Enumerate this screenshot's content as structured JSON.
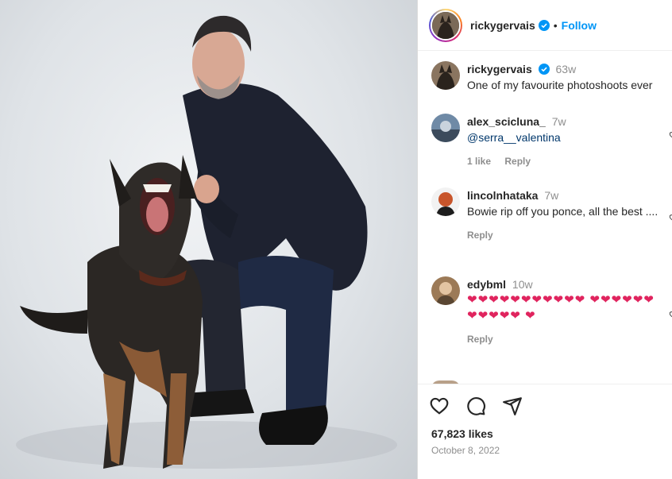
{
  "post": {
    "username": "rickygervais",
    "follow_label": "Follow",
    "dot": "•"
  },
  "caption": {
    "username": "rickygervais",
    "time": "63w",
    "text": "One of my favourite photoshoots ever"
  },
  "comments": [
    {
      "username": "alex_scicluna_",
      "time": "7w",
      "mention": "@serra__valentina",
      "likes": "1 like",
      "reply": "Reply"
    },
    {
      "username": "lincolnhataka",
      "time": "7w",
      "text": "Bowie rip off you ponce, all the best ....",
      "reply": "Reply"
    },
    {
      "username": "edybml",
      "time": "10w",
      "hearts": "❤❤❤❤❤❤❤❤❤❤❤ ❤❤❤❤❤❤❤❤❤❤❤ ❤",
      "reply": "Reply"
    }
  ],
  "footer": {
    "likes": "67,823 likes",
    "date": "October 8, 2022"
  },
  "colors": {
    "accent": "#0095f6",
    "heart": "#e0245e",
    "muted": "#8e8e8e"
  },
  "icons": [
    "verified-icon",
    "heart-icon",
    "comment-icon",
    "share-icon"
  ]
}
